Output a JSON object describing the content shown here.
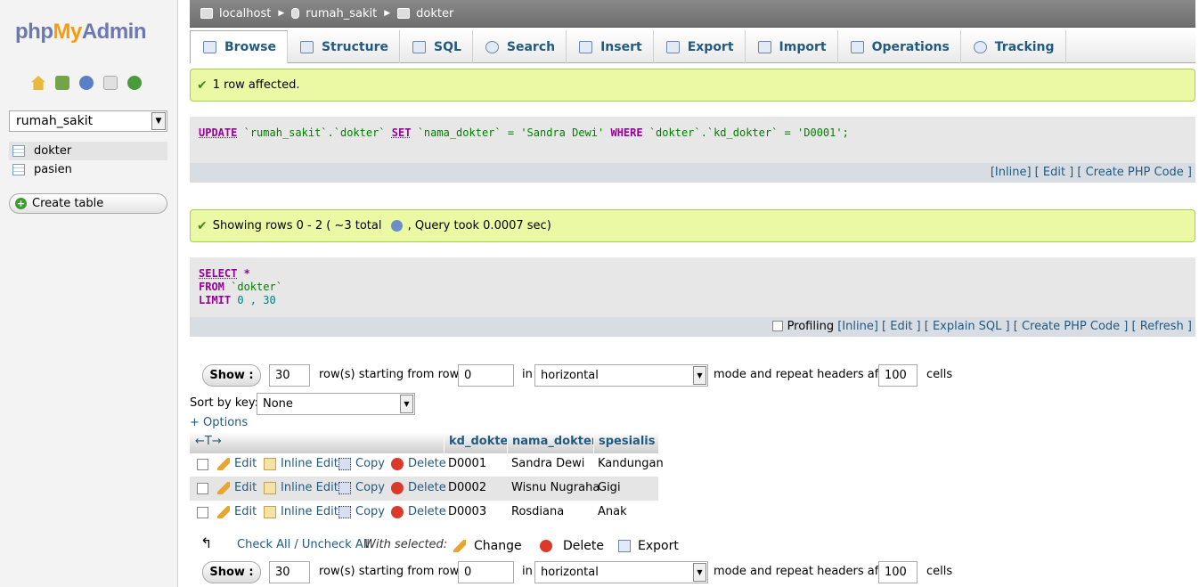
{
  "sidebar": {
    "logo": {
      "php": "php",
      "my": "My",
      "admin": "Admin"
    },
    "icons": [
      "home-icon",
      "exit-icon",
      "help-icon",
      "docs-icon",
      "reload-icon"
    ],
    "db_selected": "rumah_sakit",
    "tables": [
      "dokter",
      "pasien"
    ],
    "create_table": "Create table"
  },
  "breadcrumb": {
    "server": "localhost",
    "database": "rumah_sakit",
    "table": "dokter"
  },
  "tabs": [
    "Browse",
    "Structure",
    "SQL",
    "Search",
    "Insert",
    "Export",
    "Import",
    "Operations",
    "Tracking"
  ],
  "msg1": "1 row affected.",
  "update_sql": {
    "kw_update": "UPDATE",
    "t1": "`rumah_sakit`.`dokter`",
    "kw_set": "SET",
    "t2": "`nama_dokter` =",
    "v1": "'Sandra Dewi'",
    "kw_where": "WHERE",
    "t3": "`dokter`.`kd_dokter` =",
    "v2": "'D0001';"
  },
  "update_links": "[Inline] [ Edit ] [ Create PHP Code ]",
  "msg2": "Showing rows 0 - 2 ( ~3 total",
  "msg2b": ", Query took 0.0007 sec)",
  "select_sql": {
    "kw1": "SELECT",
    "star": " *",
    "kw2": "FROM",
    "tbl": " `dokter`",
    "kw3": "LIMIT",
    "lim": " 0 , 30"
  },
  "profiling": "Profiling",
  "select_links": "[Inline] [ Edit ] [ Explain SQL ] [ Create PHP Code ] [ Refresh ]",
  "nav": {
    "show": "Show :",
    "rows": "30",
    "rows_label": "row(s) starting from row #",
    "start": "0",
    "in": "in",
    "mode": "horizontal",
    "mode_label": "mode and repeat headers after",
    "repeat": "100",
    "cells": "cells"
  },
  "sort_label": "Sort by key:",
  "sort_value": "None",
  "options": "+ Options",
  "columns": [
    "kd_dokter",
    "nama_dokter",
    "spesialis"
  ],
  "arrows": "←T→",
  "actions": {
    "edit": "Edit",
    "inline": "Inline Edit",
    "copy": "Copy",
    "delete": "Delete"
  },
  "rows": [
    [
      "D0001",
      "Sandra Dewi",
      "Kandungan"
    ],
    [
      "D0002",
      "Wisnu Nugraha",
      "Gigi"
    ],
    [
      "D0003",
      "Rosdiana",
      "Anak"
    ]
  ],
  "footer": {
    "check_all": "Check All / Uncheck All",
    "with_selected": "With selected:",
    "change": "Change",
    "delete": "Delete",
    "export": "Export"
  }
}
